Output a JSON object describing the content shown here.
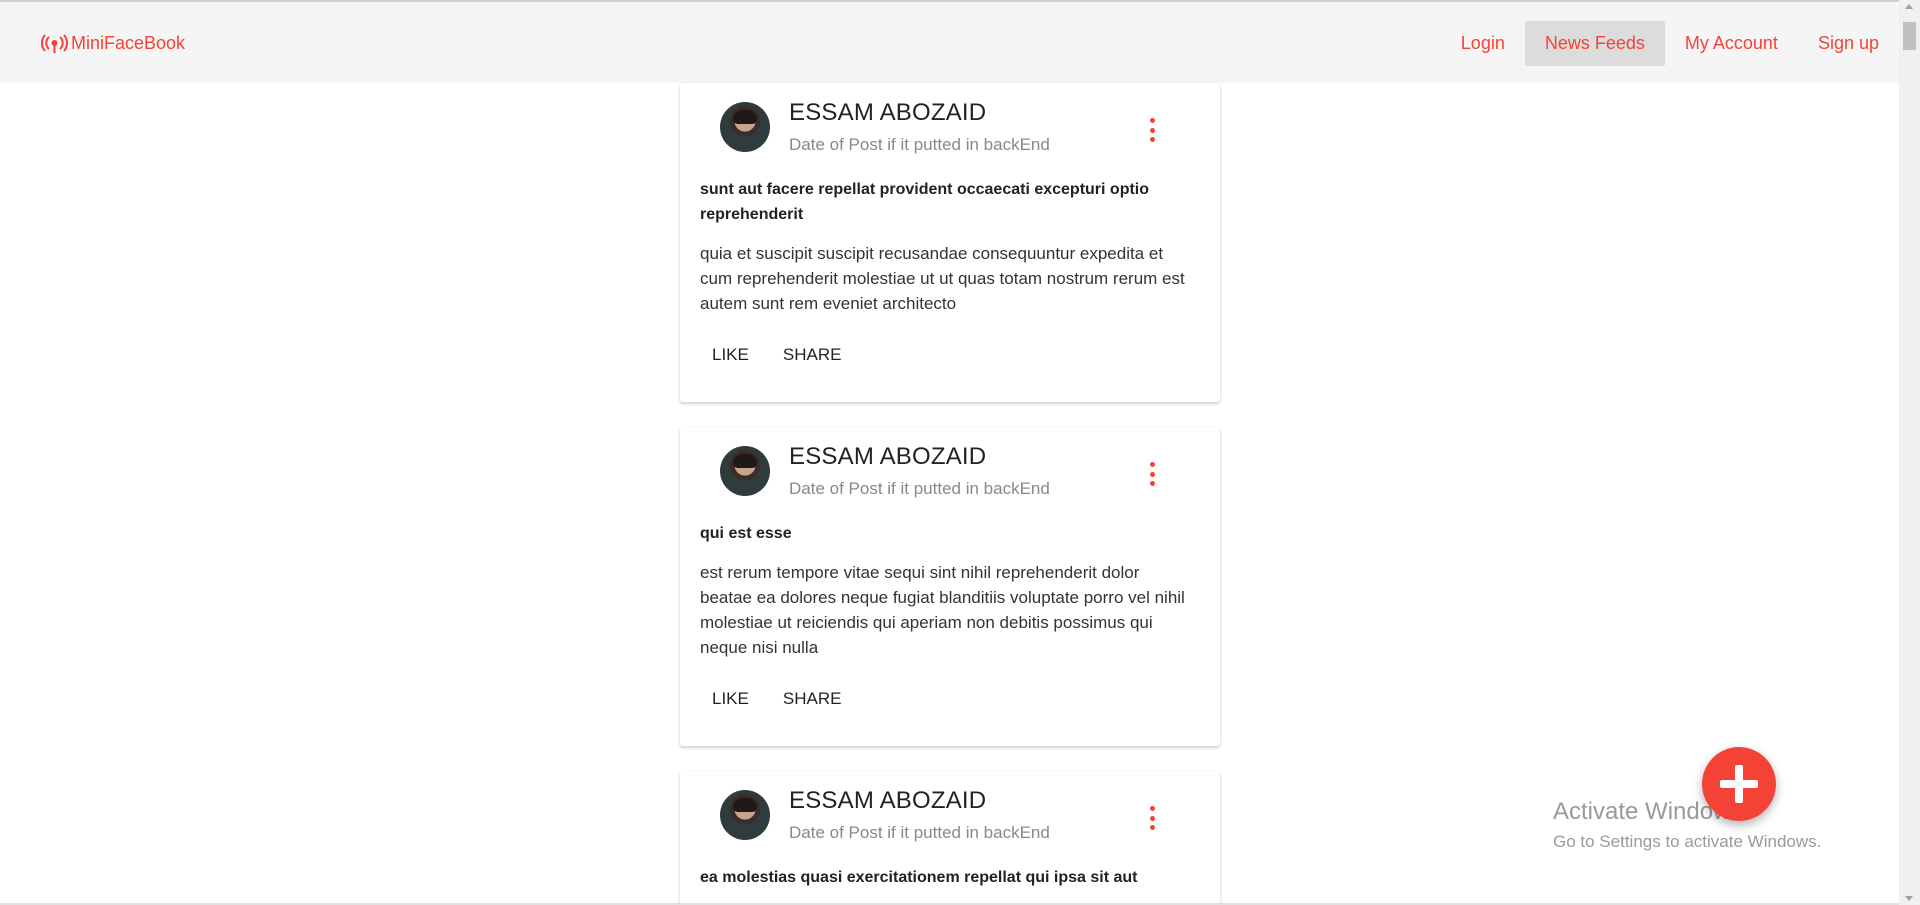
{
  "app": {
    "brand": "MiniFaceBook",
    "brand_icon": "broadcast-icon",
    "accent_color": "#f44336"
  },
  "nav": {
    "items": [
      {
        "label": "Login"
      },
      {
        "label": "News Feeds",
        "active": true
      },
      {
        "label": "My Account"
      },
      {
        "label": "Sign up"
      }
    ]
  },
  "posts": [
    {
      "author": "ESSAM ABOZAID",
      "date": "Date of Post if it putted in backEnd",
      "title": "sunt aut facere repellat provident occaecati excepturi optio reprehenderit",
      "body": "quia et suscipit suscipit recusandae consequuntur expedita et cum reprehenderit molestiae ut ut quas totam nostrum rerum est autem sunt rem eveniet architecto",
      "like_label": "LIKE",
      "share_label": "SHARE"
    },
    {
      "author": "ESSAM ABOZAID",
      "date": "Date of Post if it putted in backEnd",
      "title": "qui est esse",
      "body": "est rerum tempore vitae sequi sint nihil reprehenderit dolor beatae ea dolores neque fugiat blanditiis voluptate porro vel nihil molestiae ut reiciendis qui aperiam non debitis possimus qui neque nisi nulla",
      "like_label": "LIKE",
      "share_label": "SHARE"
    },
    {
      "author": "ESSAM ABOZAID",
      "date": "Date of Post if it putted in backEnd",
      "title": "ea molestias quasi exercitationem repellat qui ipsa sit aut"
    }
  ],
  "fab": {
    "icon": "plus-icon"
  },
  "watermark": {
    "line1": "Activate Windows",
    "line2": "Go to Settings to activate Windows."
  }
}
